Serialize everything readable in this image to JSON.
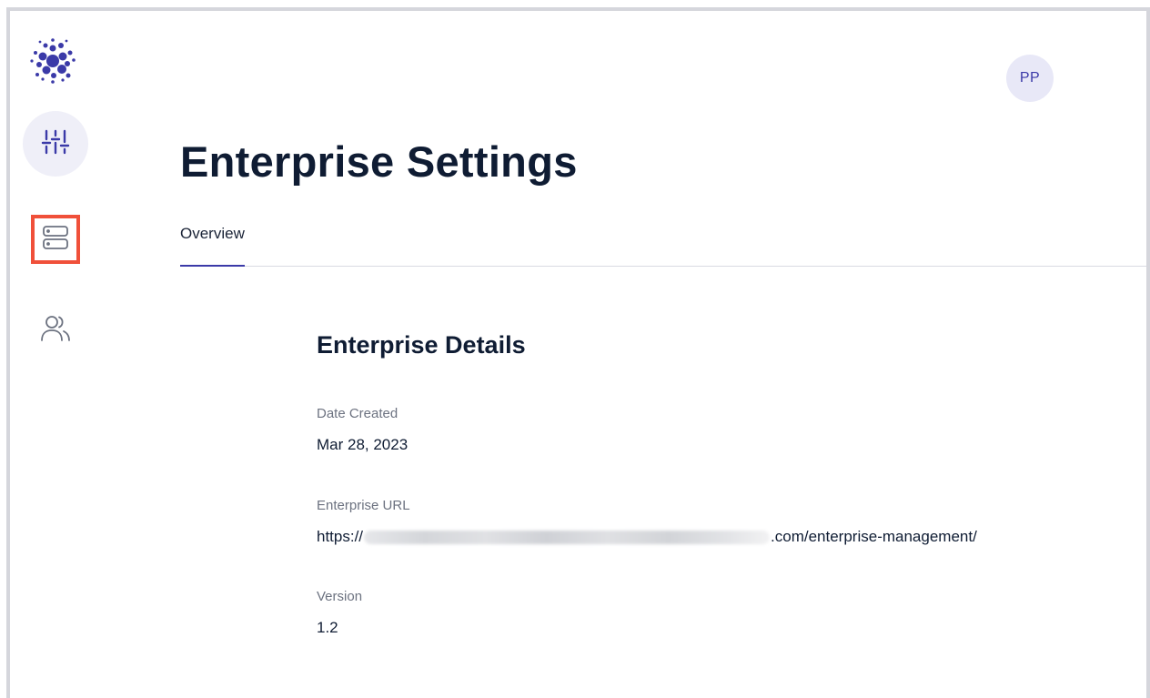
{
  "header": {
    "avatar_initials": "PP",
    "page_title": "Enterprise Settings"
  },
  "tabs": [
    {
      "label": "Overview",
      "active": true
    }
  ],
  "details": {
    "section_title": "Enterprise Details",
    "date_created_label": "Date Created",
    "date_created_value": "Mar 28, 2023",
    "url_label": "Enterprise URL",
    "url_prefix": "https://",
    "url_suffix": ".com/enterprise-management/",
    "version_label": "Version",
    "version_value": "1.2"
  },
  "sidebar": {
    "items": [
      {
        "icon": "sliders-icon",
        "active": true
      },
      {
        "icon": "server-icon",
        "highlighted": true
      },
      {
        "icon": "users-icon"
      }
    ]
  },
  "colors": {
    "accent": "#3b3aa8",
    "highlight": "#f0503a",
    "title": "#0f1c33"
  }
}
